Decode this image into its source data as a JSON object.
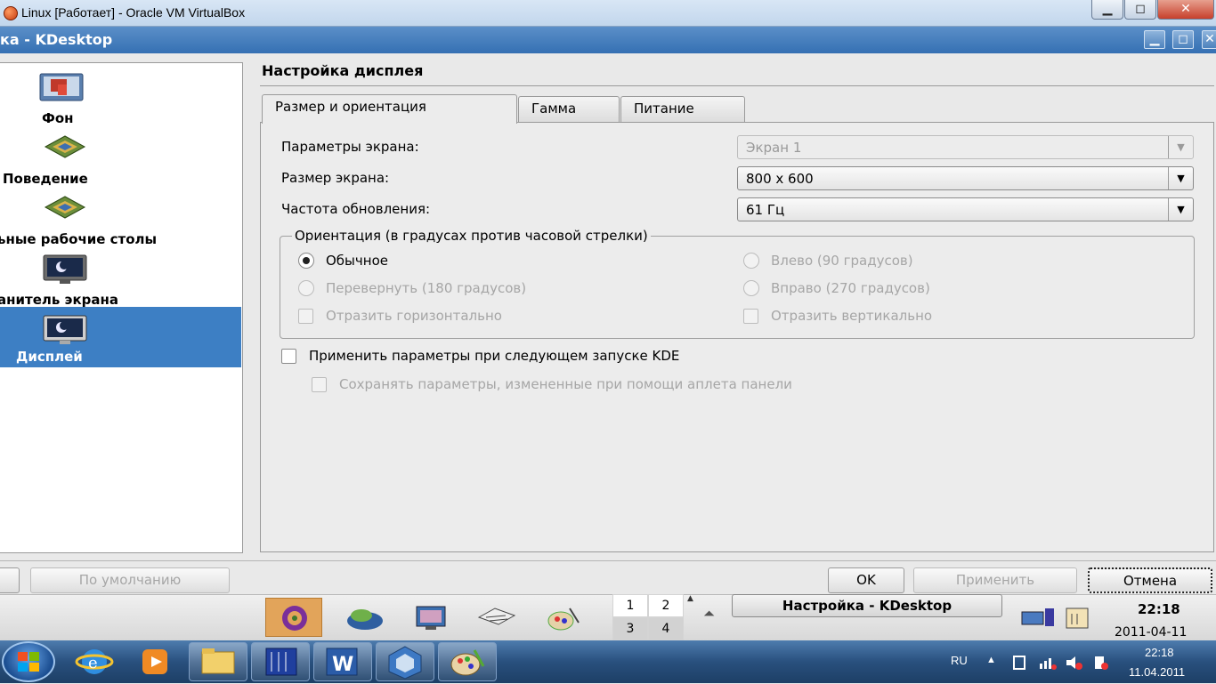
{
  "vbox": {
    "title": "Linux [Работает] - Oracle VM VirtualBox",
    "btn_min": "▁",
    "btn_max": "◻",
    "btn_close": "✕"
  },
  "window": {
    "title": "ка - KDesktop",
    "btn_min": "▁",
    "btn_max": "◻",
    "btn_close": "✕"
  },
  "sidebar": {
    "items": [
      {
        "label": "Фон",
        "icon": "wallpaper-icon"
      },
      {
        "label": "Поведение",
        "icon": "behavior-icon"
      },
      {
        "label": "ьные рабочие столы",
        "icon": "desktops-icon"
      },
      {
        "label": "анитель экрана",
        "icon": "screensaver-icon"
      },
      {
        "label": "Дисплей",
        "icon": "display-icon",
        "selected": true
      }
    ]
  },
  "main": {
    "title": "Настройка дисплея",
    "tabs": [
      {
        "label": "Размер и ориентация",
        "active": true
      },
      {
        "label": "Гамма"
      },
      {
        "label": "Питание"
      }
    ],
    "fields": {
      "screen_params_label": "Параметры экрана:",
      "screen_params_value": "Экран 1",
      "screen_size_label": "Размер экрана:",
      "screen_size_value": "800 x 600",
      "refresh_label": "Частота обновления:",
      "refresh_value": "61 Гц"
    },
    "orientation": {
      "title": "Ориентация (в градусах против часовой стрелки)",
      "normal": "Обычное",
      "left": "Влево (90 градусов)",
      "upside": "Перевернуть (180 градусов)",
      "right": "Вправо (270 градусов)",
      "flip_h": "Отразить горизонтально",
      "flip_v": "Отразить вертикально"
    },
    "apply_on_start": "Применить параметры при следующем запуске KDE",
    "save_params": "Сохранять параметры, измененные при помощи аплета панели"
  },
  "buttons": {
    "defaults": "По умолчанию",
    "ok": "OK",
    "apply": "Применить",
    "cancel": "Отмена"
  },
  "kpanel": {
    "pager": [
      "1",
      "2",
      "3",
      "4"
    ],
    "task": "Настройка - KDesktop",
    "time": "22:18",
    "date": "2011-04-11"
  },
  "taskbar": {
    "lang": "RU",
    "time": "22:18",
    "date": "11.04.2011"
  }
}
